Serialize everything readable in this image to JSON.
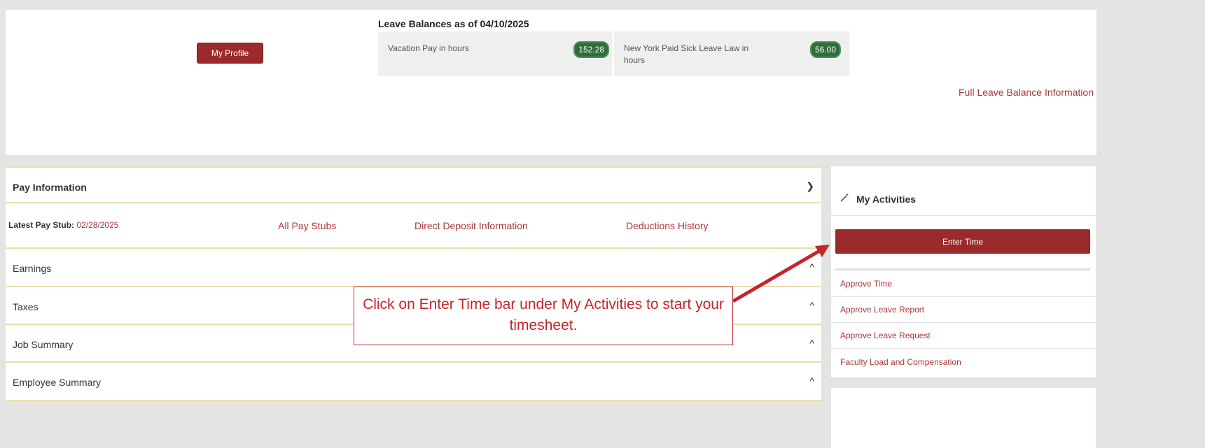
{
  "top": {
    "profile_button": "My Profile",
    "leave_title": "Leave Balances as of 04/10/2025",
    "leave": [
      {
        "label": "Vacation Pay in hours",
        "value": "152.28"
      },
      {
        "label": "New York Paid Sick Leave Law in hours",
        "value": "56.00"
      }
    ],
    "full_link": "Full Leave Balance Information"
  },
  "pay": {
    "title": "Pay Information",
    "stub_label": "Latest Pay Stub:",
    "stub_date": "02/28/2025",
    "links": [
      "All Pay Stubs",
      "Direct Deposit Information",
      "Deductions History"
    ],
    "sections": [
      "Earnings",
      "Taxes",
      "Job Summary",
      "Employee Summary"
    ]
  },
  "activities": {
    "title": "My Activities",
    "enter_time": "Enter Time",
    "items": [
      "Approve Time",
      "Approve Leave Report",
      "Approve Leave Request",
      "Faculty Load and Compensation"
    ]
  },
  "callout": "Click on Enter Time bar under My Activities to start your timesheet.",
  "colors": {
    "accent": "#9b2a2a",
    "link": "#a9373b",
    "callout": "#c3262b",
    "pill": "#2f6e3b"
  }
}
